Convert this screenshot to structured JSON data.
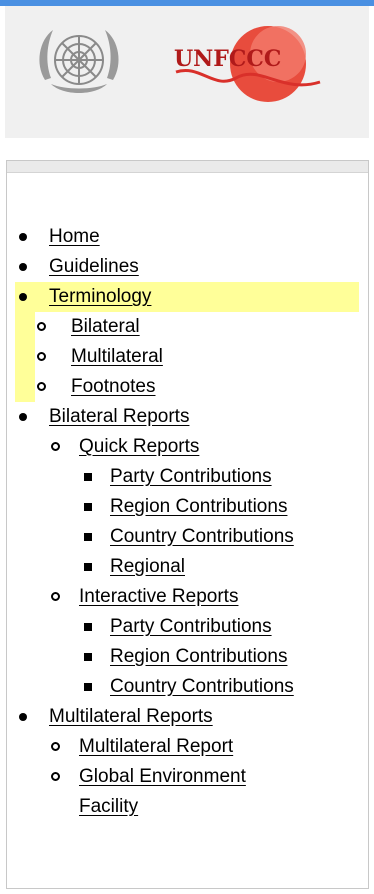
{
  "brand": {
    "unfccc_text": "UNFCCC",
    "colors": {
      "top_bar": "#4a90e2",
      "highlight": "#ffff99",
      "unfccc_red": "#d9302a"
    }
  },
  "nav": {
    "items": [
      {
        "label": "Home"
      },
      {
        "label": "Guidelines"
      },
      {
        "label": "Terminology"
      },
      {
        "label": "Bilateral"
      },
      {
        "label": "Multilateral"
      },
      {
        "label": "Footnotes"
      },
      {
        "label": "Bilateral Reports"
      },
      {
        "label": "Quick Reports"
      },
      {
        "label": "Party Contributions"
      },
      {
        "label": "Region Contributions"
      },
      {
        "label": "Country Contributions"
      },
      {
        "label": "Regional"
      },
      {
        "label": "Interactive Reports"
      },
      {
        "label": "Party Contributions"
      },
      {
        "label": "Region Contributions"
      },
      {
        "label": "Country Contributions"
      },
      {
        "label": "Multilateral Reports"
      },
      {
        "label": "Multilateral Report"
      },
      {
        "label": "Global Environment"
      },
      {
        "label": "Facility"
      }
    ]
  }
}
